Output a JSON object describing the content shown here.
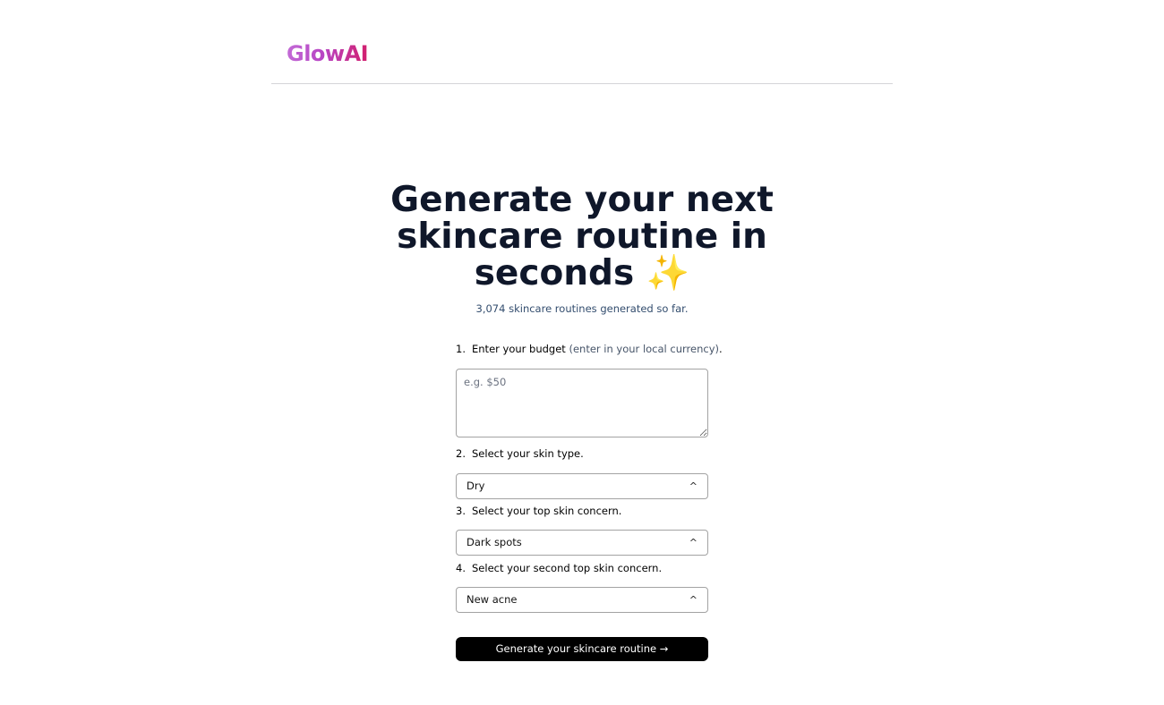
{
  "header": {
    "logo": "GlowAI"
  },
  "hero": {
    "title": "Generate your next skincare routine in seconds",
    "sparkle": "✨",
    "subtitle": "3,074 skincare routines generated so far."
  },
  "form": {
    "step1": {
      "number": "1.",
      "label": "Enter your budget ",
      "hint": "(enter in your local currency)",
      "suffix": ".",
      "placeholder": "e.g. $50"
    },
    "step2": {
      "number": "2.",
      "label": "Select your skin type.",
      "value": "Dry"
    },
    "step3": {
      "number": "3.",
      "label": "Select your top skin concern.",
      "value": "Dark spots"
    },
    "step4": {
      "number": "4.",
      "label": "Select your second top skin concern.",
      "value": "New acne"
    },
    "submit_label": "Generate your skincare routine →"
  },
  "icons": {
    "select_chevron": "chevron-up-icon"
  }
}
